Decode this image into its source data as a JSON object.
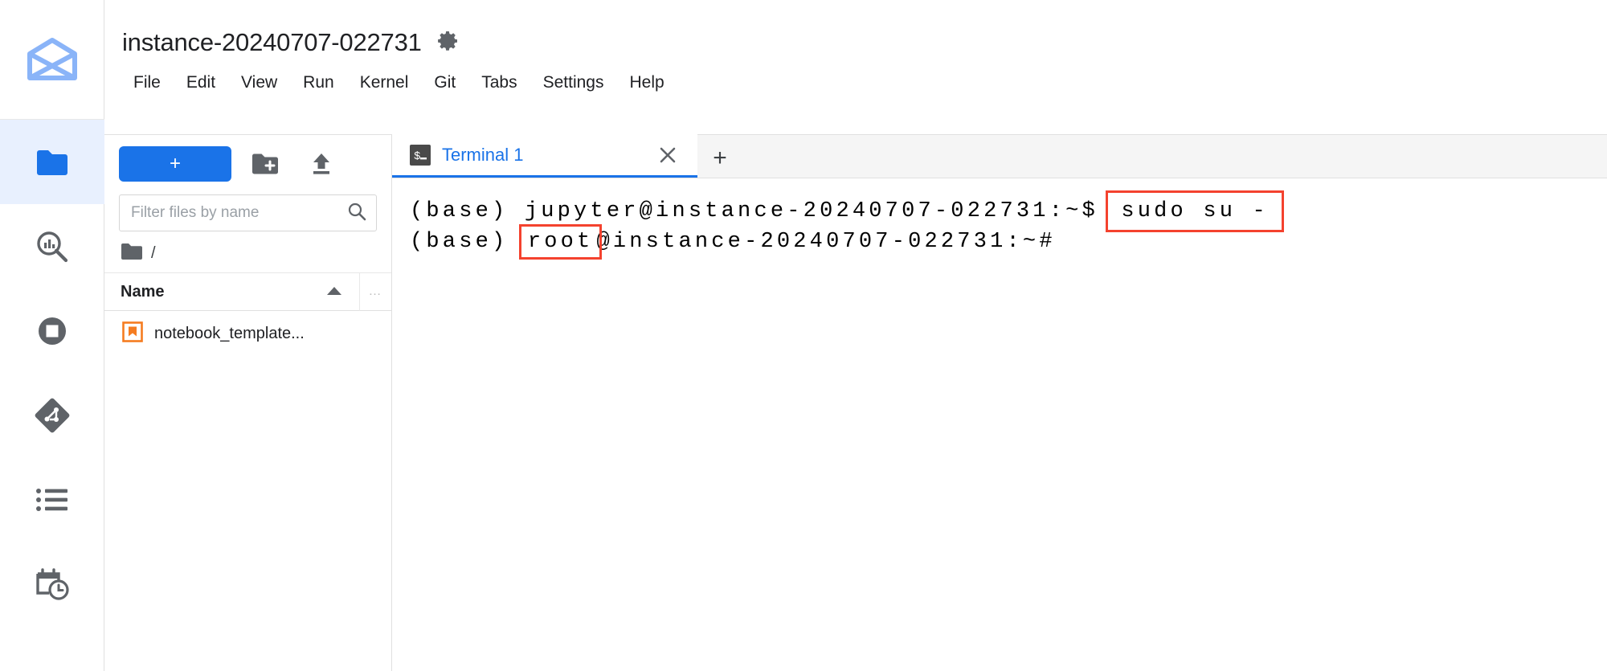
{
  "app": {
    "logo_icon": "vertex-ai-workbench-logo"
  },
  "header": {
    "instance_title": "instance-20240707-022731",
    "settings_icon": "gear-icon",
    "menus": [
      {
        "label": "File"
      },
      {
        "label": "Edit"
      },
      {
        "label": "View"
      },
      {
        "label": "Run"
      },
      {
        "label": "Kernel"
      },
      {
        "label": "Git"
      },
      {
        "label": "Tabs"
      },
      {
        "label": "Settings"
      },
      {
        "label": "Help"
      }
    ]
  },
  "activity_bar": {
    "items": [
      {
        "name": "file-browser",
        "icon": "folder-icon",
        "active": true
      },
      {
        "name": "search-and-replace",
        "icon": "search-chart-icon",
        "active": false
      },
      {
        "name": "running-terminals-kernels",
        "icon": "stop-square-icon",
        "active": false
      },
      {
        "name": "git",
        "icon": "git-icon",
        "active": false
      },
      {
        "name": "table-of-contents",
        "icon": "list-bullets-icon",
        "active": false
      },
      {
        "name": "notebook-scheduler",
        "icon": "calendar-clock-icon",
        "active": false
      }
    ]
  },
  "file_browser": {
    "new_launcher_label": "+",
    "new_folder_icon": "new-folder-icon",
    "upload_icon": "upload-icon",
    "filter": {
      "placeholder": "Filter files by name",
      "value": "",
      "icon": "search-icon"
    },
    "breadcrumb": {
      "root_icon": "folder-icon",
      "path": "/"
    },
    "columns": {
      "name_label": "Name",
      "sort_direction": "ascending",
      "more_label": "…"
    },
    "files": [
      {
        "name": "notebook_template...",
        "icon": "notebook-icon",
        "icon_color": "#f57c20"
      }
    ]
  },
  "dock": {
    "tabs": [
      {
        "label": "Terminal 1",
        "icon": "terminal-prompt-icon",
        "active": true,
        "close_icon": "close-icon"
      }
    ],
    "new_tab_label": "+"
  },
  "terminal": {
    "lines": [
      {
        "segments": [
          {
            "text": "(base) jupyter@instance-20240707-022731:~$ ",
            "highlight": false
          },
          {
            "text": "sudo su -",
            "highlight": "command"
          }
        ]
      },
      {
        "segments": [
          {
            "text": "(base) ",
            "highlight": false
          },
          {
            "text": "root",
            "highlight": "token"
          },
          {
            "text": "@instance-20240707-022731:~#",
            "highlight": false
          }
        ]
      }
    ]
  },
  "colors": {
    "accent_blue": "#1a73e8",
    "active_tab_blue": "#1a73e8",
    "annotation_red": "#f4422e",
    "notebook_orange": "#f57c20",
    "logo_blue": "#8ab4f8",
    "sidebar_active_bg": "#e8f0fe"
  }
}
